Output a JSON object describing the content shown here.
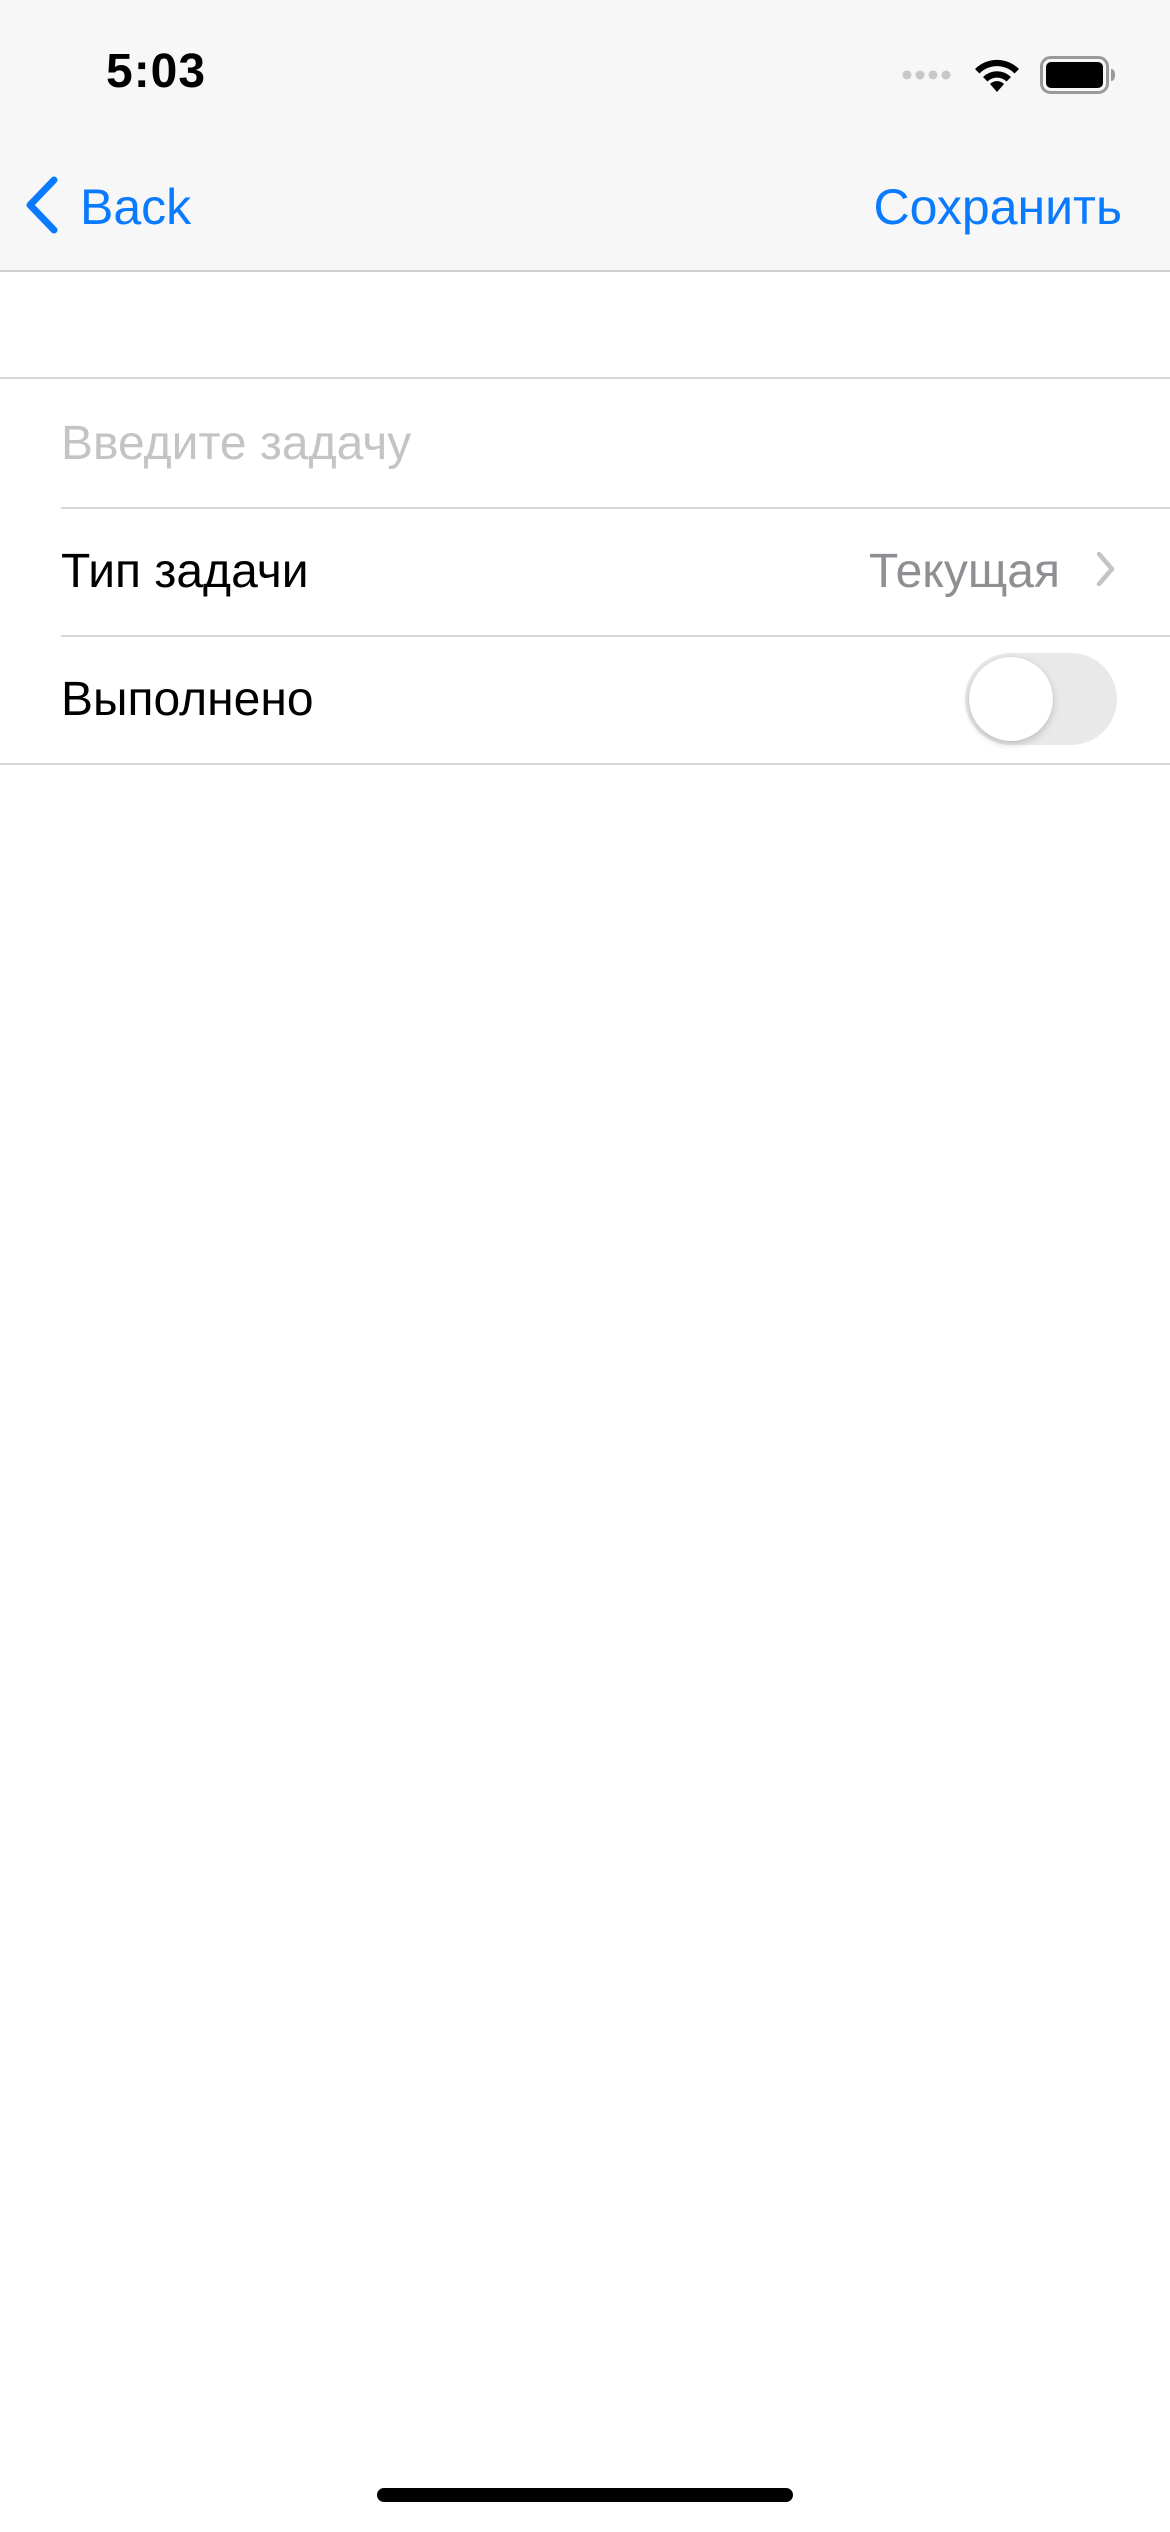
{
  "status_bar": {
    "time": "5:03",
    "icons": [
      "cellular-signal-icon",
      "wifi-icon",
      "battery-icon"
    ]
  },
  "nav_bar": {
    "back_label": "Back",
    "save_label": "Сохранить"
  },
  "form": {
    "task_input": {
      "value": "",
      "placeholder": "Введите задачу"
    },
    "task_type": {
      "label": "Тип задачи",
      "value": "Текущая"
    },
    "done": {
      "label": "Выполнено",
      "checked": false
    }
  },
  "colors": {
    "accent": "#0a7aff",
    "nav_background": "#f7f7f7",
    "separator": "#d6d6d9",
    "placeholder": "#c4c4c6",
    "secondary_text": "#8e8e93",
    "toggle_off": "#e9e9ea"
  }
}
